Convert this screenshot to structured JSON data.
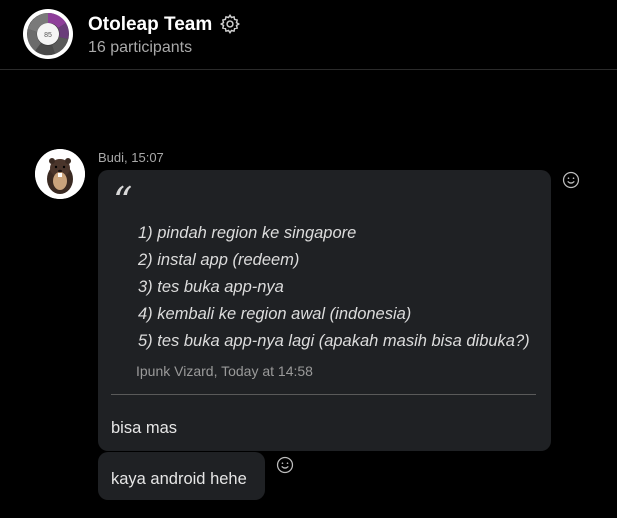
{
  "header": {
    "title": "Otoleap Team",
    "participants": "16 participants",
    "avatar_badge": "85",
    "settings_icon": "gear-icon"
  },
  "message": {
    "sender": "Budi",
    "time": "15:07",
    "meta": "Budi, 15:07",
    "quote": {
      "mark": "“",
      "lines": [
        "1) pindah region ke singapore",
        "2) instal app (redeem)",
        "3) tes buka app-nya",
        "4) kembali ke region awal (indonesia)",
        "5) tes buka app-nya lagi (apakah masih bisa dibuka?)"
      ],
      "attribution": "Ipunk Vizard, Today at 14:58"
    },
    "reply": "bisa mas",
    "followup": "kaya android hehe",
    "reaction_icon": "smiley-icon"
  },
  "colors": {
    "background": "#000000",
    "bubble": "#1f2124",
    "text": "#e6e6e6",
    "muted": "#a9a9a9"
  }
}
